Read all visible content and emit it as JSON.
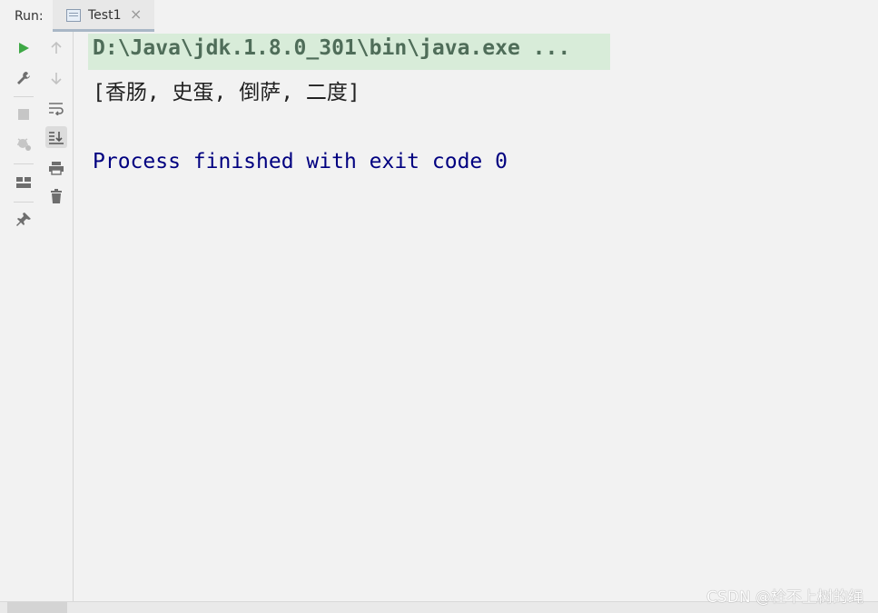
{
  "header": {
    "run_label": "Run:",
    "tab_title": "Test1",
    "tab_close": "×"
  },
  "toolbar_left": [
    {
      "name": "rerun-icon",
      "color": "#3ea845"
    },
    {
      "name": "wrench-icon",
      "color": "#6e6e6e"
    },
    {
      "name": "stop-icon",
      "color": "#c6c6c6"
    },
    {
      "name": "debug-settings-icon",
      "color": "#c6c6c6"
    },
    {
      "name": "layout-icon",
      "color": "#6e6e6e"
    },
    {
      "name": "pin-icon",
      "color": "#6e6e6e"
    }
  ],
  "toolbar_right": [
    {
      "name": "up-arrow-icon"
    },
    {
      "name": "down-arrow-icon"
    },
    {
      "name": "soft-wrap-icon"
    },
    {
      "name": "scroll-to-end-icon"
    },
    {
      "name": "print-icon"
    },
    {
      "name": "trash-icon"
    }
  ],
  "console": {
    "command_line": "D:\\Java\\jdk.1.8.0_301\\bin\\java.exe ...",
    "output_line": "[香肠, 史蛋, 倒萨, 二度]",
    "process_line": "Process finished with exit code 0"
  },
  "watermark": "CSDN @栓不上树的绳",
  "colors": {
    "command_bg": "#d8ecd9",
    "command_text": "#4f6d59",
    "process_text": "#000080"
  }
}
